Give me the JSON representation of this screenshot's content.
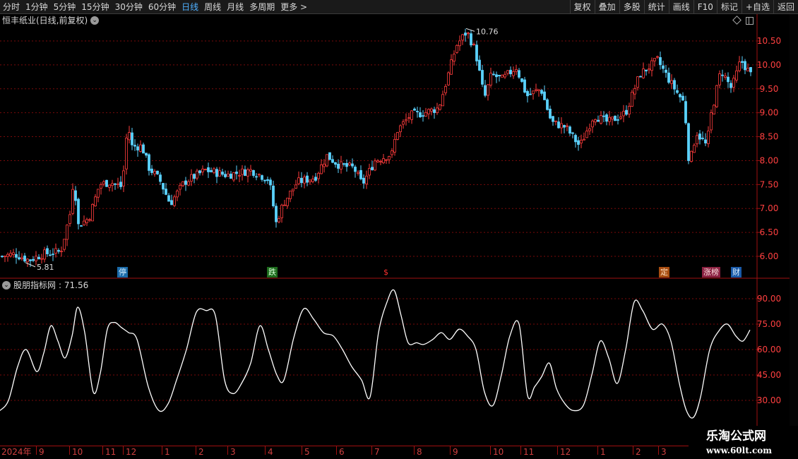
{
  "toolbar": {
    "periods": [
      "分时",
      "1分钟",
      "5分钟",
      "15分钟",
      "30分钟",
      "60分钟",
      "日线",
      "周线",
      "月线",
      "多周期",
      "更多 >"
    ],
    "active_period": "日线",
    "buttons": [
      "复权",
      "叠加",
      "多股",
      "统计",
      "画线",
      "F10",
      "标记",
      "+自选",
      "返回"
    ]
  },
  "stock_title": "恒丰纸业(日线,前复权)",
  "indicator": {
    "name": "股朋指标网",
    "value_label": ": 71.56"
  },
  "markers": {
    "ting": "停",
    "die": "跌",
    "s": "$",
    "ding": "定",
    "zhang": "涨榜",
    "cai": "财"
  },
  "price_annotations": {
    "high": "10.76",
    "low": "5.81"
  },
  "date_axis": {
    "year": "2024年",
    "months": [
      "9",
      "10",
      "11",
      "12",
      "1",
      "2",
      "3",
      "4",
      "5",
      "6",
      "7",
      "8",
      "9",
      "10",
      "11",
      "12",
      "1",
      "2",
      "3"
    ]
  },
  "watermark": {
    "title": "乐淘公式网",
    "url": "www.60lt.com"
  },
  "colors": {
    "up": "#ff3c3c",
    "down": "#5ad2ff",
    "grid": "#7a0a0a",
    "axis_text": "#ff4040",
    "line": "#ffffff"
  },
  "chart_data": [
    {
      "type": "candlestick",
      "title": "恒丰纸业(日线,前复权)",
      "y_ticks": [
        6.0,
        6.5,
        7.0,
        7.5,
        8.0,
        8.5,
        9.0,
        9.5,
        10.0,
        10.5
      ],
      "y_tick_labels": [
        "6.00",
        "6.50",
        "7.00",
        "7.50",
        "8.00",
        "8.50",
        "9.00",
        "9.50",
        "10.00",
        "10.50"
      ],
      "ylim": [
        5.6,
        10.9
      ],
      "close_path": [
        [
          0,
          6.0
        ],
        [
          20,
          6.05
        ],
        [
          40,
          5.92
        ],
        [
          60,
          6.05
        ],
        [
          85,
          6.1
        ],
        [
          100,
          7.0
        ],
        [
          103,
          7.7
        ],
        [
          110,
          6.65
        ],
        [
          125,
          6.8
        ],
        [
          140,
          7.5
        ],
        [
          155,
          7.55
        ],
        [
          172,
          7.45
        ],
        [
          180,
          8.8
        ],
        [
          185,
          8.3
        ],
        [
          200,
          8.3
        ],
        [
          210,
          7.85
        ],
        [
          225,
          7.6
        ],
        [
          240,
          7.1
        ],
        [
          260,
          7.55
        ],
        [
          290,
          7.8
        ],
        [
          320,
          7.7
        ],
        [
          355,
          7.8
        ],
        [
          380,
          7.6
        ],
        [
          390,
          6.7
        ],
        [
          400,
          7.1
        ],
        [
          420,
          7.55
        ],
        [
          445,
          7.65
        ],
        [
          462,
          8.1
        ],
        [
          480,
          7.9
        ],
        [
          500,
          7.85
        ],
        [
          512,
          7.5
        ],
        [
          530,
          8.0
        ],
        [
          555,
          8.15
        ],
        [
          560,
          8.6
        ],
        [
          580,
          8.95
        ],
        [
          600,
          9.0
        ],
        [
          620,
          9.1
        ],
        [
          632,
          9.7
        ],
        [
          645,
          10.4
        ],
        [
          660,
          10.7
        ],
        [
          672,
          10.3
        ],
        [
          685,
          9.3
        ],
        [
          695,
          9.8
        ],
        [
          710,
          9.7
        ],
        [
          730,
          9.95
        ],
        [
          745,
          9.35
        ],
        [
          765,
          9.5
        ],
        [
          780,
          8.8
        ],
        [
          800,
          8.7
        ],
        [
          820,
          8.3
        ],
        [
          840,
          8.95
        ],
        [
          860,
          8.8
        ],
        [
          885,
          9.0
        ],
        [
          905,
          9.8
        ],
        [
          930,
          10.1
        ],
        [
          950,
          9.6
        ],
        [
          968,
          9.2
        ],
        [
          975,
          7.9
        ],
        [
          985,
          8.6
        ],
        [
          1000,
          8.3
        ],
        [
          1005,
          8.9
        ],
        [
          1020,
          9.9
        ],
        [
          1035,
          9.5
        ],
        [
          1048,
          10.1
        ],
        [
          1062,
          9.8
        ]
      ]
    },
    {
      "type": "line",
      "series": [
        {
          "name": "股朋指标网",
          "last_value": 71.56
        }
      ],
      "y_ticks": [
        30,
        45,
        60,
        75,
        90
      ],
      "y_tick_labels": [
        "30.00",
        "45.00",
        "60.00",
        "75.00",
        "90.00"
      ],
      "ylim": [
        20,
        97
      ],
      "points": [
        [
          0,
          24
        ],
        [
          12,
          30
        ],
        [
          25,
          50
        ],
        [
          37,
          60
        ],
        [
          52,
          47
        ],
        [
          62,
          58
        ],
        [
          72,
          74
        ],
        [
          82,
          65
        ],
        [
          92,
          55
        ],
        [
          102,
          68
        ],
        [
          110,
          85
        ],
        [
          120,
          70
        ],
        [
          132,
          35
        ],
        [
          142,
          46
        ],
        [
          152,
          72
        ],
        [
          162,
          76
        ],
        [
          172,
          73
        ],
        [
          182,
          70
        ],
        [
          194,
          66
        ],
        [
          210,
          38
        ],
        [
          225,
          24
        ],
        [
          238,
          28
        ],
        [
          250,
          42
        ],
        [
          264,
          60
        ],
        [
          278,
          82
        ],
        [
          292,
          83
        ],
        [
          305,
          80
        ],
        [
          318,
          42
        ],
        [
          330,
          34
        ],
        [
          342,
          40
        ],
        [
          355,
          52
        ],
        [
          368,
          74
        ],
        [
          380,
          60
        ],
        [
          392,
          45
        ],
        [
          402,
          42
        ],
        [
          416,
          67
        ],
        [
          430,
          84
        ],
        [
          444,
          78
        ],
        [
          458,
          70
        ],
        [
          472,
          68
        ],
        [
          485,
          60
        ],
        [
          498,
          50
        ],
        [
          512,
          42
        ],
        [
          524,
          32
        ],
        [
          536,
          70
        ],
        [
          548,
          88
        ],
        [
          558,
          95
        ],
        [
          568,
          80
        ],
        [
          578,
          64
        ],
        [
          590,
          64
        ],
        [
          600,
          63
        ],
        [
          613,
          66
        ],
        [
          625,
          70
        ],
        [
          637,
          66
        ],
        [
          650,
          72
        ],
        [
          662,
          68
        ],
        [
          674,
          60
        ],
        [
          686,
          35
        ],
        [
          698,
          27
        ],
        [
          710,
          45
        ],
        [
          722,
          68
        ],
        [
          735,
          75
        ],
        [
          747,
          33
        ],
        [
          757,
          38
        ],
        [
          767,
          44
        ],
        [
          778,
          52
        ],
        [
          788,
          37
        ],
        [
          800,
          28
        ],
        [
          812,
          24
        ],
        [
          826,
          27
        ],
        [
          838,
          45
        ],
        [
          850,
          65
        ],
        [
          862,
          55
        ],
        [
          874,
          40
        ],
        [
          886,
          60
        ],
        [
          898,
          88
        ],
        [
          910,
          83
        ],
        [
          924,
          72
        ],
        [
          938,
          75
        ],
        [
          950,
          65
        ],
        [
          962,
          40
        ],
        [
          972,
          24
        ],
        [
          982,
          20
        ],
        [
          992,
          32
        ],
        [
          1005,
          60
        ],
        [
          1018,
          71
        ],
        [
          1030,
          75
        ],
        [
          1042,
          68
        ],
        [
          1052,
          65
        ],
        [
          1062,
          71.56
        ]
      ]
    }
  ]
}
